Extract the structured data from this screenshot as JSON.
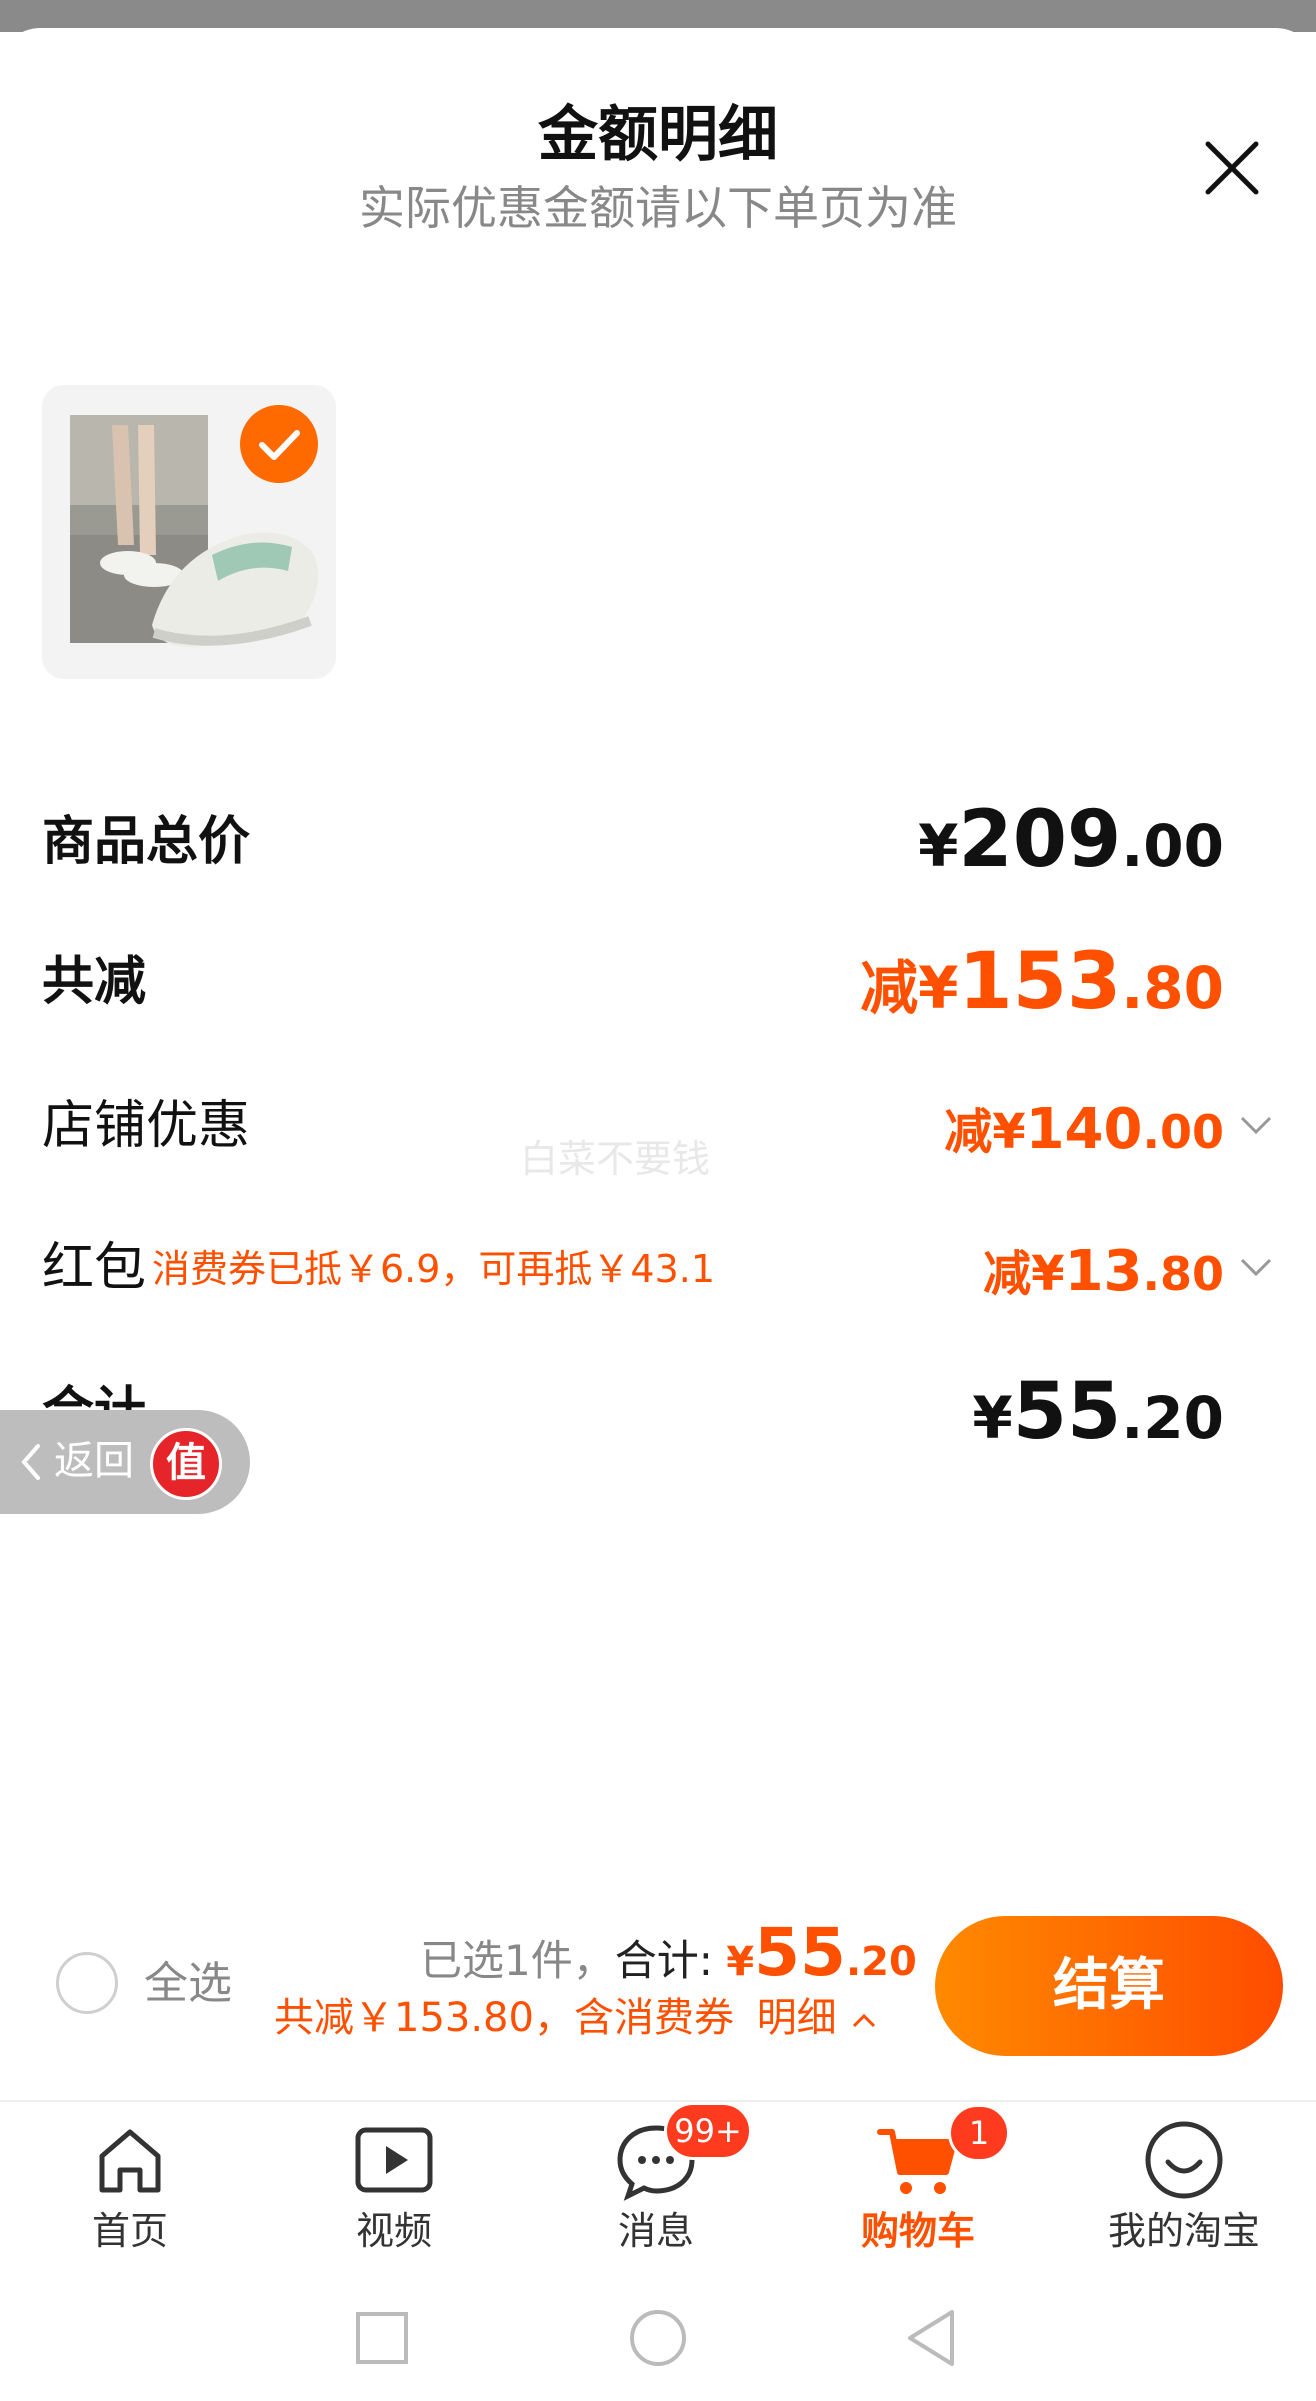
{
  "header": {
    "title": "金额明细",
    "subtitle": "实际优惠金额请以下单页为准",
    "close_icon": "close-icon"
  },
  "product": {
    "image_alt": "sneaker product photo",
    "selected": true
  },
  "breakdown": {
    "total": {
      "label": "商品总价",
      "yen": "¥",
      "int": "209",
      "cents": ".00"
    },
    "discount": {
      "label": "共减",
      "prefix": "减¥",
      "int": "153",
      "cents": ".80"
    },
    "shop": {
      "label": "店铺优惠",
      "prefix": "减¥",
      "int": "140",
      "cents": ".00"
    },
    "redpacket": {
      "label": "红包",
      "note": "消费券已抵￥6.9，可再抵￥43.1",
      "prefix": "减¥",
      "int": "13",
      "cents": ".80"
    },
    "subtotal": {
      "label": "合计",
      "yen": "¥",
      "int": "55",
      "cents": ".20"
    }
  },
  "watermark": "白菜不要钱",
  "floating_back": {
    "label": "返回",
    "badge": "值"
  },
  "bottom_bar": {
    "select_all": "全选",
    "selected_text": "已选1件，",
    "total_label": "合计: ",
    "total_yen": "¥",
    "total_int": "55",
    "total_cents": ".20",
    "savings_text": "共减￥153.80，含消费券",
    "detail_link": "明细",
    "checkout": "结算"
  },
  "tabs": [
    {
      "label": "首页",
      "icon": "home-icon"
    },
    {
      "label": "视频",
      "icon": "video-icon"
    },
    {
      "label": "消息",
      "icon": "message-icon",
      "badge": "99+"
    },
    {
      "label": "购物车",
      "icon": "cart-icon",
      "badge": "1",
      "active": true
    },
    {
      "label": "我的淘宝",
      "icon": "profile-icon"
    }
  ],
  "colors": {
    "accent": "#ff5000",
    "checkout_start": "#ff8a00",
    "checkout_end": "#ff4c00"
  }
}
